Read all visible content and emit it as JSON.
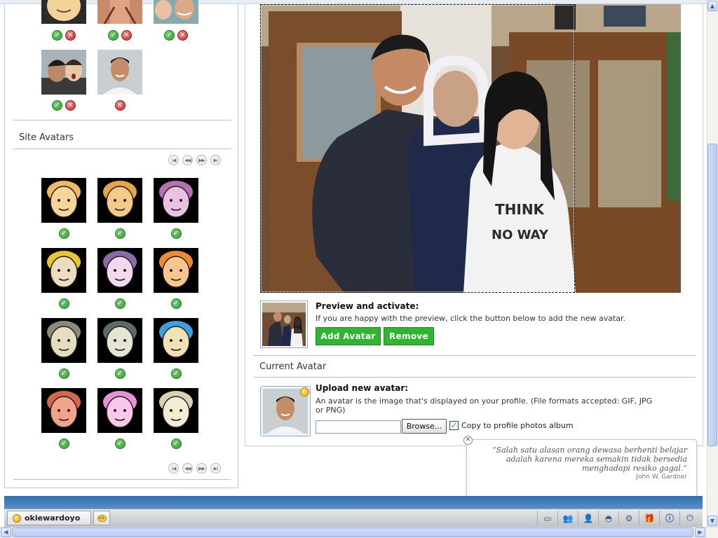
{
  "left_panel": {
    "section_title": "Site Avatars",
    "user_avatars": [
      {
        "actions": [
          "approve",
          "delete"
        ]
      },
      {
        "actions": [
          "approve",
          "delete"
        ]
      },
      {
        "actions": [
          "approve",
          "delete"
        ]
      },
      {
        "actions": [
          "approve",
          "delete"
        ]
      },
      {
        "actions": [
          "delete"
        ]
      }
    ],
    "site_avatars": [
      {
        "face": "#f6d49a",
        "hair": "#f0b860"
      },
      {
        "face": "#f6c98a",
        "hair": "#e8a548"
      },
      {
        "face": "#e8c2e0",
        "hair": "#b86fb0"
      },
      {
        "face": "#eddcc0",
        "hair": "#e8c430"
      },
      {
        "face": "#f3d8ef",
        "hair": "#8a6aa8"
      },
      {
        "face": "#f8c590",
        "hair": "#ee8a34"
      },
      {
        "face": "#e6dcc0",
        "hair": "#8a8a7a"
      },
      {
        "face": "#e8e4d4",
        "hair": "#5a6a64"
      },
      {
        "face": "#f2e1b4",
        "hair": "#3aa0e0"
      },
      {
        "face": "#f2a48a",
        "hair": "#d06a4a"
      },
      {
        "face": "#f8c8ea",
        "hair": "#e890d8"
      },
      {
        "face": "#f2ecd0",
        "hair": "#d8d2b0"
      }
    ],
    "pager_icons": [
      "first-icon",
      "prev-icon",
      "next-icon",
      "last-icon"
    ]
  },
  "main": {
    "preview_title": "Preview and activate:",
    "preview_desc": "If you are happy with the preview, click the button below to add the new avatar.",
    "add_button": "Add Avatar",
    "remove_button": "Remove",
    "current_title": "Current Avatar",
    "upload_title": "Upload new avatar:",
    "upload_desc": "An avatar is the image that's displayed on your profile. (File formats accepted: GIF, JPG or PNG)",
    "file_value": "",
    "browse_button": "Browse...",
    "copy_checked": true,
    "copy_label": "Copy to profile photos album",
    "accent_green": "#2fb52f"
  },
  "quote": {
    "line1": "“Salah satu alasan orang dewasa berhenti belajar",
    "line2": "adalah karena mereka semakin tidak bersedia",
    "line3": "menghadapi resiko gagal.”",
    "author": "John W. Gardner"
  },
  "taskbar": {
    "username": "okiewardoyo",
    "icons": [
      "photo-icon",
      "friends-icon",
      "profile-icon",
      "games-icon",
      "settings-icon",
      "gift-icon",
      "info-icon",
      "power-icon"
    ]
  }
}
